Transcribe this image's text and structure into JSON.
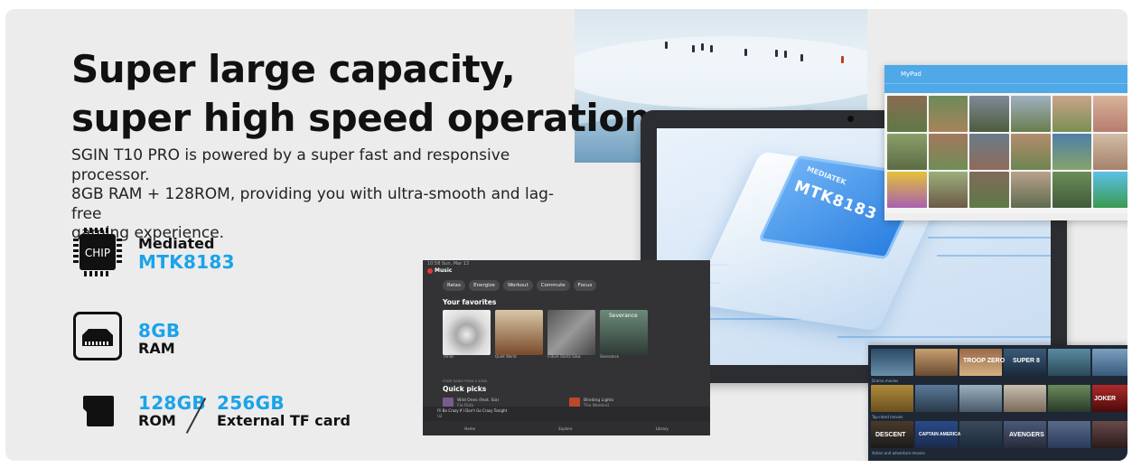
{
  "headline": {
    "line1": "Super large capacity,",
    "line2": "super high speed operation"
  },
  "description": {
    "line1": "SGIN T10 PRO is powered by a super fast and responsive processor.",
    "line2": "8GB RAM + 128ROM, providing you with ultra-smooth and lag-free",
    "line3": "gaming experience."
  },
  "specs": {
    "chip": {
      "icon": "chip-icon",
      "icon_text": "CHIP",
      "label": "Mediated",
      "value": "MTK8183"
    },
    "ram": {
      "icon": "ram-card-icon",
      "value": "8GB",
      "label": "RAM"
    },
    "storage": {
      "icon": "sd-card-icon",
      "rom_value": "128GB",
      "rom_label": "ROM",
      "tf_value": "256GB",
      "tf_label": "External TF card"
    }
  },
  "tablet": {
    "chip_brand": "MEDIATEK",
    "chip_model": "MTK8183"
  },
  "gallery_app": {
    "title": "MyPad"
  },
  "music_app": {
    "status": "10:58  Sun, Mar 13",
    "app_name": "Music",
    "chips": [
      "Relax",
      "Energize",
      "Workout",
      "Commute",
      "Focus"
    ],
    "your_favorites": "Your favorites",
    "albums": [
      {
        "caption": "Thrills"
      },
      {
        "caption": "Quiet World"
      },
      {
        "caption": "Future Starts Slow"
      },
      {
        "caption": "Severance"
      }
    ],
    "album_title_severance": "Severance",
    "quick_picks_sub": "START RADIO FROM A SONG",
    "quick_picks": "Quick picks",
    "quick_items": [
      {
        "title": "Wild Ones (feat. Sia)",
        "artist": "Flo Rida"
      },
      {
        "title": "Blinding Lights",
        "artist": "The Weeknd"
      }
    ],
    "now_playing": "I'll Be Crazy If I Don't Go Crazy Tonight",
    "now_playing_artist": "U2",
    "nav": [
      "Home",
      "Explore",
      "Library"
    ]
  },
  "stream_app": {
    "tiles_text": [
      "SUPER 8",
      "TROOP ZERO",
      "CAPTAIN AMERICA",
      "AVENGERS",
      "DESCENT",
      "JOKER"
    ],
    "row_labels": [
      "Drama movies",
      "Top-rated movies",
      "Action and adventure movies"
    ]
  },
  "colors": {
    "accent": "#1aa3ea",
    "background": "#ececec",
    "headline": "#111111"
  }
}
